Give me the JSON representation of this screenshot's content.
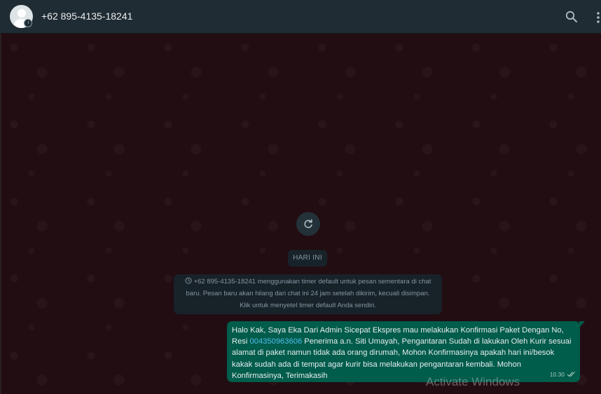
{
  "header": {
    "contact_name": "+62 895-4135-18241",
    "avatar_icon": "default-user-avatar",
    "search_icon": "search-icon",
    "menu_icon": "vertical-dots-icon"
  },
  "chat": {
    "reload_icon": "refresh-icon",
    "date_label": "HARI INI",
    "system_message": {
      "icon": "timer-icon",
      "text": "+62 895-4135-18241 menggunakan timer default untuk pesan sementara di chat baru. Pesan baru akan hilang dari chat ini 24 jam setelah dikirim, kecuali disimpan. Klik untuk menyetel timer default Anda sendiri."
    },
    "message": {
      "text_before": "Halo Kak, Saya Eka Dari Admin Sicepat Ekspres mau melakukan Konfirmasi Paket Dengan No, Resi ",
      "link": "004350963606",
      "text_after": " Penerima a.n. Siti Umayah, Pengantaran Sudah di lakukan Oleh Kurir sesuai alamat di paket namun tidak ada orang dirumah, Mohon Konfirmasinya apakah hari ini/besok kakak sudah ada di tempat agar kurir bisa melakukan pengantaran kembali. Mohon Konfirmasinya, Terimakasih",
      "time": "10.30",
      "status_icon": "double-check-icon"
    }
  },
  "watermark": "Activate Windows",
  "colors": {
    "header_bg": "#202c33",
    "chat_bg": "#220d12",
    "outgoing_bubble": "#005c4b",
    "link": "#53bdeb",
    "system_bg": "#182229"
  }
}
